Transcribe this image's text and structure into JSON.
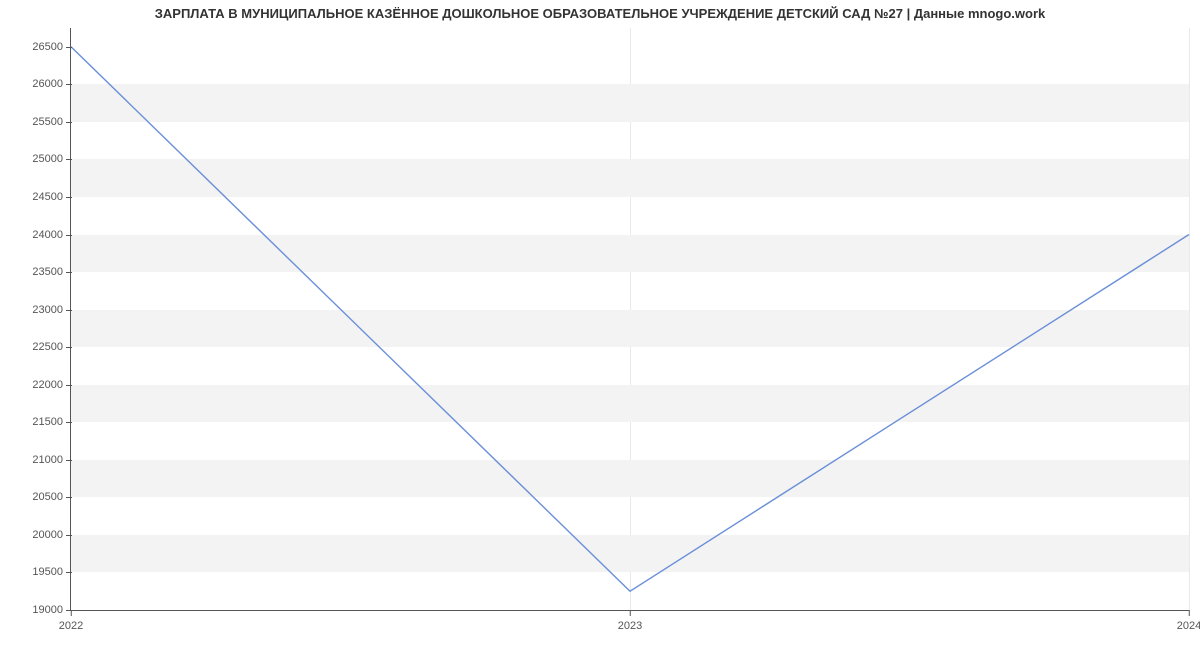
{
  "chart_data": {
    "type": "line",
    "title": "ЗАРПЛАТА В МУНИЦИПАЛЬНОЕ КАЗЁННОЕ ДОШКОЛЬНОЕ ОБРАЗОВАТЕЛЬНОЕ УЧРЕЖДЕНИЕ ДЕТСКИЙ САД №27 | Данные mnogo.work",
    "x": [
      2022,
      2023,
      2024
    ],
    "values": [
      26500,
      19250,
      24000
    ],
    "x_ticks": [
      2022,
      2023,
      2024
    ],
    "y_ticks": [
      19000,
      19500,
      20000,
      20500,
      21000,
      21500,
      22000,
      22500,
      23000,
      23500,
      24000,
      24500,
      25000,
      25500,
      26000,
      26500
    ],
    "xlim": [
      2022,
      2024
    ],
    "ylim": [
      19000,
      26750
    ],
    "xlabel": "",
    "ylabel": "",
    "line_color": "#6a8fd8"
  }
}
